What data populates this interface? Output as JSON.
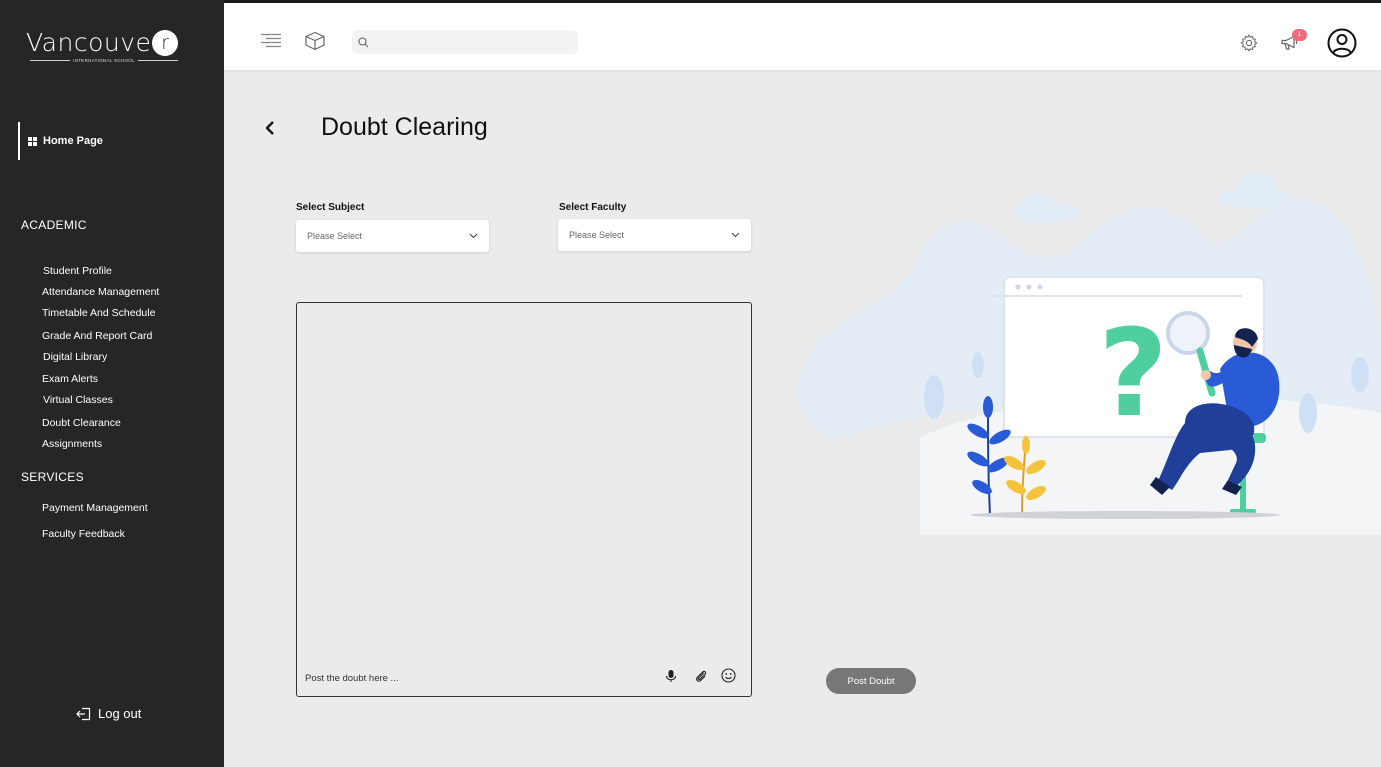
{
  "brand": {
    "logo_main": "Vancouve",
    "logo_circle_letter": "r",
    "logo_sub": "INTERNATIONAL SCHOOL"
  },
  "sidebar": {
    "home": "Home Page",
    "academic_title": "ACADEMIC",
    "academic_items": [
      "Student Profile",
      "Attendance Management",
      "Timetable And Schedule",
      "Grade And Report Card",
      "Digital Library",
      "Exam Alerts",
      "Virtual Classes",
      "Doubt Clearance",
      "Assignments"
    ],
    "services_title": "SERVICES",
    "services_items": [
      "Payment Management",
      "Faculty Feedback"
    ],
    "logout": "Log out"
  },
  "topbar": {
    "search_placeholder": "",
    "notification_count": "1",
    "icons": [
      "menu-icon",
      "cube-icon",
      "search-icon",
      "gear-icon",
      "megaphone-icon",
      "user-avatar-icon"
    ]
  },
  "main": {
    "title": "Doubt Clearing",
    "subject_label": "Select Subject",
    "subject_value": "Please Select",
    "faculty_label": "Select Faculty",
    "faculty_value": "Please Select",
    "doubt_placeholder": "Post the doubt here ...",
    "post_button": "Post Doubt"
  },
  "colors": {
    "sidebar_bg": "#262626",
    "page_bg": "#ebebeb",
    "badge": "#ef6a7c",
    "button": "#777777",
    "question_mark": "#4fcf9e",
    "character_blue": "#2a5bd7"
  }
}
